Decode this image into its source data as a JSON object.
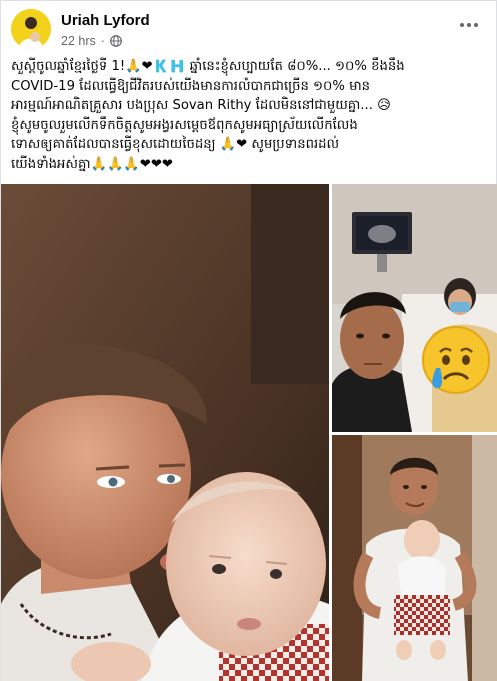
{
  "post": {
    "author": "Uriah Lyford",
    "time": "22 hrs",
    "separator": "·",
    "caption_lines": [
      "សួស្ដីចូលឆ្នាំខ្មែរថ្ងៃទី 1!🙏❤🇰🇭 ឆ្នាំនេះខ្ញុំសប្បាយតែ ៨០%... ១០% ខឹងនឹង",
      "COVID-19 ដែលធ្វើឱ្យជីវិតរបស់យើងមានការលំបាកជាច្រើន ១០% មាន",
      "អារម្មណ៍អាណិតគ្រួសារ បងប្រុស Sovan Rithy ដែលមិននៅជាមួយគ្នា... 😥",
      " ខ្ញុំសូមចូលរួមលើកទឹកចិត្តសូមអង្វរសម្ដេចឪពុកសូមអធ្យាស្រ័យលើកលែង",
      "ទោសឲ្យគាត់ដែលបានធ្វើខុសដោយចៃដន្យ 🙏❤ សូមប្រទានពរដល់",
      "យើងទាំងអស់គ្នា🙏🙏🙏❤❤❤"
    ]
  },
  "icons": {
    "avatar": "profile-avatar",
    "globe": "globe-icon",
    "more": "more-options-icon",
    "crying": "crying-face-emoji"
  },
  "colors": {
    "meta_text": "#65676b",
    "avatar_bg": "#f2d21a"
  }
}
